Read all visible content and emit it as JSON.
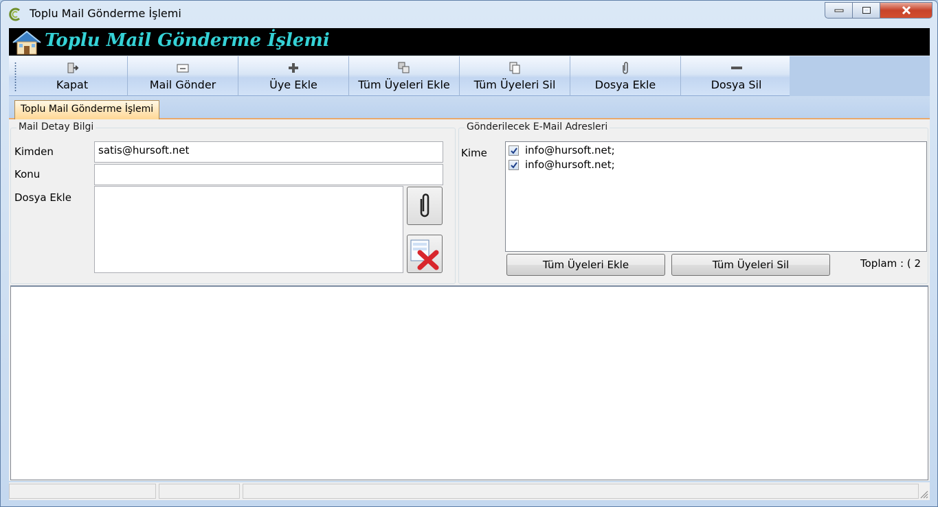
{
  "window": {
    "title": "Toplu Mail Gönderme İşlemi",
    "icons": {
      "app": "app-logo-icon",
      "minimize": "minimize-icon",
      "maximize": "maximize-icon",
      "close": "close-icon"
    }
  },
  "banner": {
    "title": "Toplu Mail Gönderme İşlemi",
    "icon": "home-icon"
  },
  "toolbar": {
    "items": [
      {
        "label": "Kapat",
        "icon": "exit-door-icon"
      },
      {
        "label": "Mail Gönder",
        "icon": "envelope-icon"
      },
      {
        "label": "Üye Ekle",
        "icon": "plus-icon"
      },
      {
        "label": "Tüm Üyeleri Ekle",
        "icon": "add-all-icon"
      },
      {
        "label": "Tüm Üyeleri Sil",
        "icon": "remove-all-icon"
      },
      {
        "label": "Dosya Ekle",
        "icon": "paperclip-icon"
      },
      {
        "label": "Dosya Sil",
        "icon": "minus-icon"
      }
    ]
  },
  "tab": {
    "label": "Toplu Mail Gönderme İşlemi"
  },
  "mail_detail": {
    "group_title": "Mail Detay Bilgi",
    "from_label": "Kimden",
    "from_value": "satis@hursoft.net",
    "subject_label": "Konu",
    "subject_value": "",
    "attach_label": "Dosya Ekle",
    "attach_value": ""
  },
  "recipients": {
    "group_title": "Gönderilecek E-Mail Adresleri",
    "to_label": "Kime",
    "items": [
      {
        "email": "info@hursoft.net;",
        "checked": true
      },
      {
        "email": "info@hursoft.net;",
        "checked": true
      }
    ],
    "add_all_label": "Tüm Üyeleri Ekle",
    "remove_all_label": "Tüm Üyeleri Sil",
    "total_text": "Toplam : ( 2"
  },
  "colors": {
    "banner_text": "#35d2d6",
    "banner_bg": "#000000",
    "tab_accent": "#ffd794",
    "close_button": "#c7432a"
  }
}
